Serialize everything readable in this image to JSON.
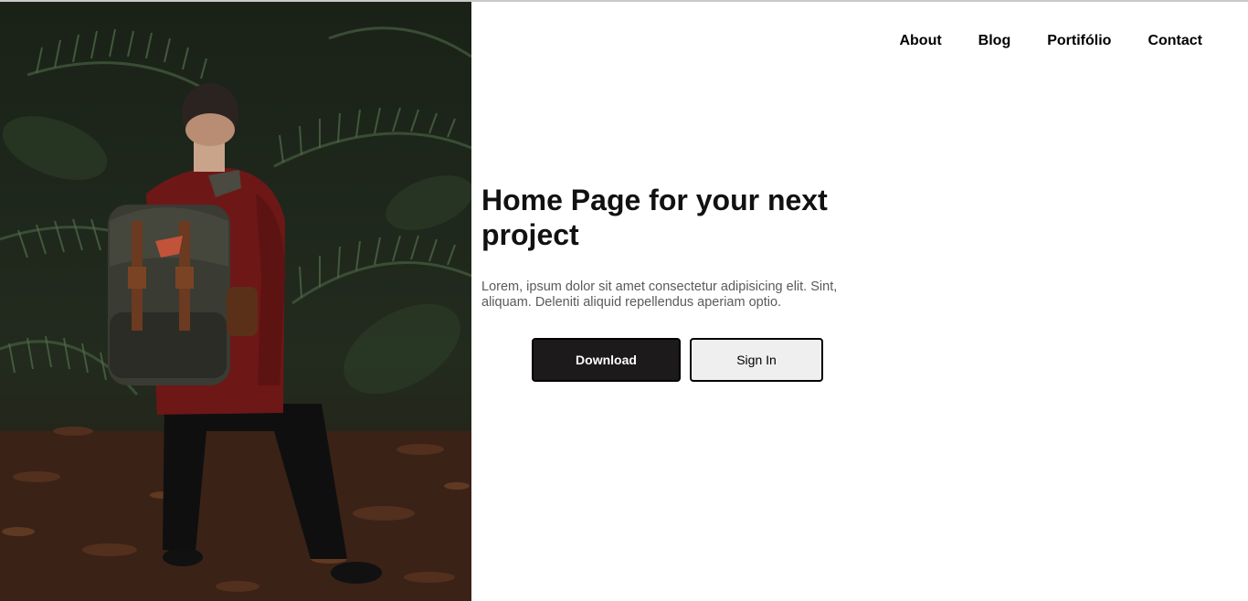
{
  "nav": {
    "items": [
      {
        "label": "About"
      },
      {
        "label": "Blog"
      },
      {
        "label": "Portifólio"
      },
      {
        "label": "Contact"
      }
    ]
  },
  "hero": {
    "title": "Home Page for your next project",
    "description": "Lorem, ipsum dolor sit amet consectetur adipisicing elit. Sint, aliquam. Deleniti aliquid repellendus aperiam optio.",
    "primary_button": "Download",
    "secondary_button": "Sign In",
    "image": "photo of hiker with backpack among jungle palm leaves"
  },
  "colors": {
    "primary_button_bg": "#1c1a1a",
    "secondary_button_bg": "#efefef",
    "text": "#111111",
    "muted_text": "#5a5a5a"
  }
}
